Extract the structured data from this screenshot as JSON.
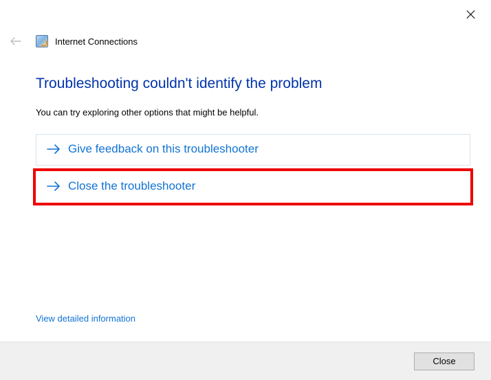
{
  "window": {
    "app_title": "Internet Connections"
  },
  "main": {
    "heading": "Troubleshooting couldn't identify the problem",
    "subtext": "You can try exploring other options that might be helpful.",
    "options": [
      {
        "label": "Give feedback on this troubleshooter"
      },
      {
        "label": "Close the troubleshooter"
      }
    ],
    "detailed_link": "View detailed information"
  },
  "footer": {
    "close_label": "Close"
  }
}
